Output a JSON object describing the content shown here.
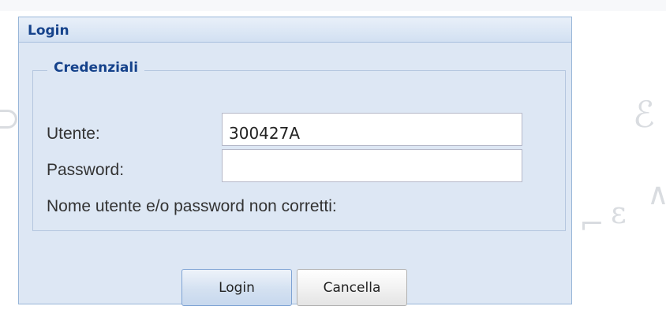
{
  "window": {
    "title": "Login"
  },
  "credentials": {
    "legend": "Credenziali",
    "username_label": "Utente:",
    "username_value": "300427A",
    "password_label": "Password:",
    "password_value": "",
    "error_message": "Nome utente e/o password non corretti:"
  },
  "buttons": {
    "login_label": "Login",
    "cancel_label": "Cancella"
  },
  "colors": {
    "window_background": "#dde7f4",
    "title_text": "#15428b",
    "body_text": "#333333",
    "border": "#98b6d8"
  }
}
